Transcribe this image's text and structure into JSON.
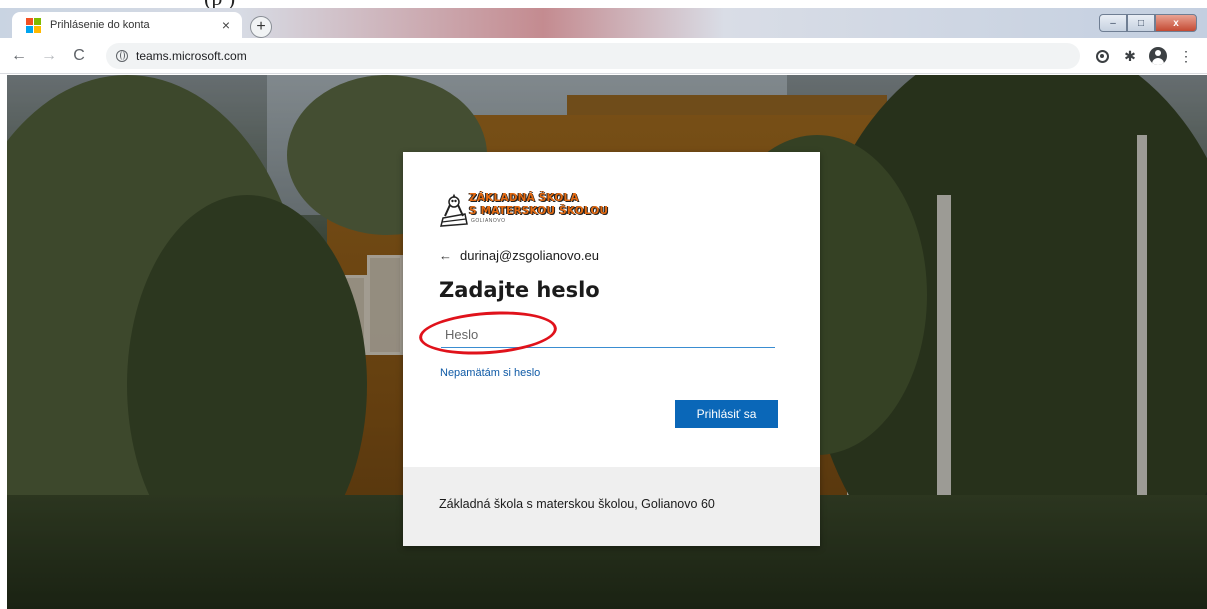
{
  "paper": {
    "glyph": "(p        )"
  },
  "browser": {
    "tab": {
      "title": "Prihlásenie do konta",
      "close_glyph": "×"
    },
    "new_tab_glyph": "+",
    "window_controls": {
      "minimize": "–",
      "maximize": "□",
      "close": "x"
    },
    "nav": {
      "back": "←",
      "forward": "→",
      "reload": "C"
    },
    "address": {
      "url": "teams.microsoft.com"
    },
    "menu_glyph": "⋮",
    "puzzle_glyph": "✱"
  },
  "login": {
    "logo": {
      "line1": "ZÁKLADNÁ ŠKOLA",
      "line2": "S MATERSKOU ŠKOLOU",
      "small": "GOLIANOVO"
    },
    "back_arrow": "←",
    "identity": "durinaj@zsgolianovo.eu",
    "title": "Zadajte heslo",
    "password_placeholder": "Heslo",
    "forgot_link": "Nepamätám si heslo",
    "signin_button": "Prihlásiť sa",
    "footer": "Základná škola s materskou školou, Golianovo 60"
  },
  "colors": {
    "accent_blue": "#0a67b8",
    "link_blue": "#0f5aa6",
    "annotation_red": "#e0121b",
    "logo_orange": "#e36a12"
  }
}
